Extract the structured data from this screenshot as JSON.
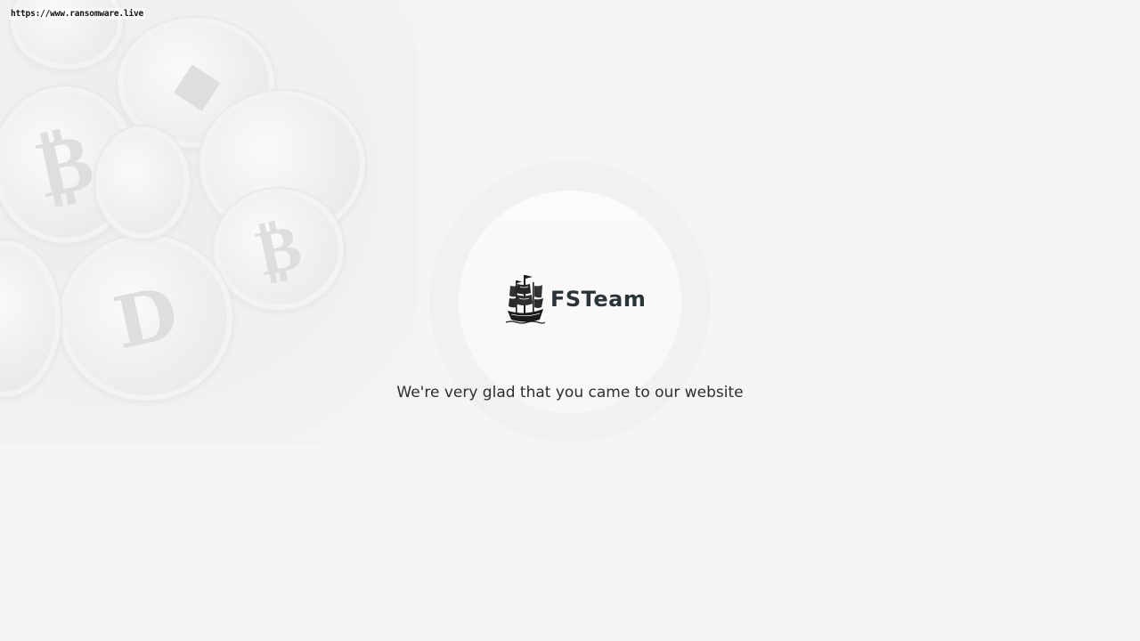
{
  "watermark": {
    "url": "https://www.ransomware.live"
  },
  "brand": {
    "logo_icon": "pirate-ship-icon",
    "name": "FSTeam"
  },
  "main": {
    "tagline": "We're very glad that you came to our website"
  },
  "background": {
    "decoration": "cryptocurrency-coins",
    "coin_icons": [
      "bitcoin-icon",
      "ethereum-icon",
      "dash-icon"
    ]
  },
  "colors": {
    "page_background": "#f5f5f5",
    "text_primary": "#2b3538"
  }
}
